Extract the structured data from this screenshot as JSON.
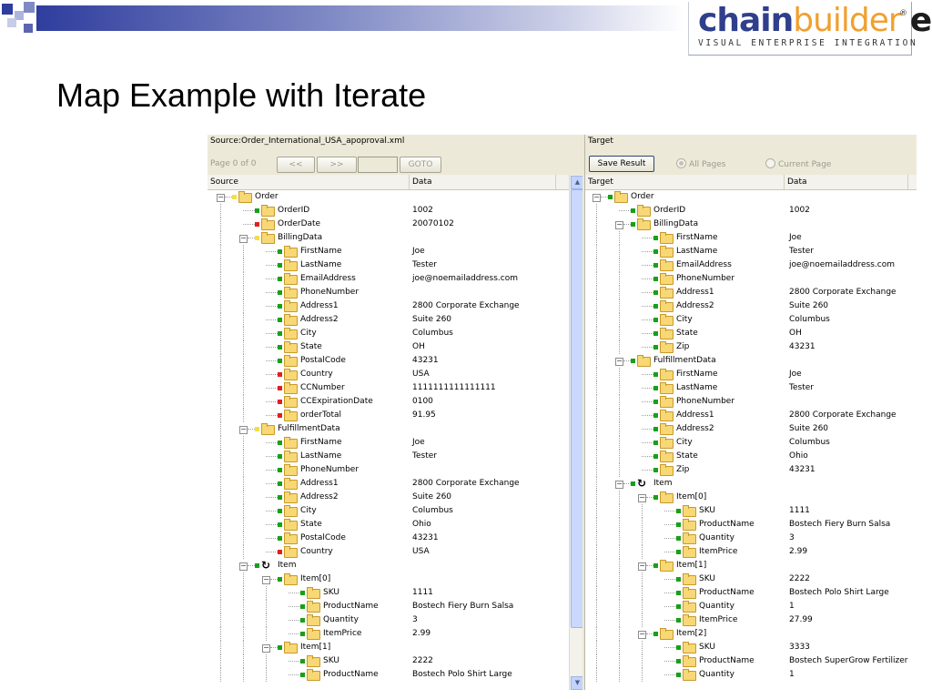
{
  "slide": {
    "title": "Map Example with Iterate",
    "logo": {
      "chain": "chain",
      "builder": "builder",
      "esb": "esb",
      "reg": "®",
      "tagline": "VISUAL ENTERPRISE INTEGRATION"
    },
    "colors": {
      "bar_dark": "#2f3d9e",
      "bar_light": "#c9cde6",
      "logo_blue": "#2f3f8c",
      "logo_orange": "#f0a030"
    }
  },
  "source_panel": {
    "header": "Source:Order_International_USA_apoproval.xml",
    "page_label": "Page 0 of 0",
    "prev_label": "<<",
    "next_label": ">>",
    "goto_label": "GOTO",
    "col_source": "Source",
    "col_data": "Data",
    "rows": [
      {
        "name": "Order",
        "value": "",
        "level": 0,
        "marker": "yellow",
        "icon": "folder",
        "expander": "minus"
      },
      {
        "name": "OrderID",
        "value": "1002",
        "level": 1,
        "marker": "green",
        "icon": "folder"
      },
      {
        "name": "OrderDate",
        "value": "20070102",
        "level": 1,
        "marker": "red",
        "icon": "folder"
      },
      {
        "name": "BillingData",
        "value": "",
        "level": 1,
        "marker": "yellow",
        "icon": "folder",
        "expander": "minus"
      },
      {
        "name": "FirstName",
        "value": "Joe",
        "level": 2,
        "marker": "green",
        "icon": "folder"
      },
      {
        "name": "LastName",
        "value": "Tester",
        "level": 2,
        "marker": "green",
        "icon": "folder"
      },
      {
        "name": "EmailAddress",
        "value": "joe@noemailaddress.com",
        "level": 2,
        "marker": "green",
        "icon": "folder"
      },
      {
        "name": "PhoneNumber",
        "value": "",
        "level": 2,
        "marker": "green",
        "icon": "folder"
      },
      {
        "name": "Address1",
        "value": "2800 Corporate Exchange",
        "level": 2,
        "marker": "green",
        "icon": "folder"
      },
      {
        "name": "Address2",
        "value": "Suite 260",
        "level": 2,
        "marker": "green",
        "icon": "folder"
      },
      {
        "name": "City",
        "value": "Columbus",
        "level": 2,
        "marker": "green",
        "icon": "folder"
      },
      {
        "name": "State",
        "value": "OH",
        "level": 2,
        "marker": "green",
        "icon": "folder"
      },
      {
        "name": "PostalCode",
        "value": "43231",
        "level": 2,
        "marker": "green",
        "icon": "folder"
      },
      {
        "name": "Country",
        "value": "USA",
        "level": 2,
        "marker": "red",
        "icon": "folder"
      },
      {
        "name": "CCNumber",
        "value": "1111111111111111",
        "level": 2,
        "marker": "red",
        "icon": "folder"
      },
      {
        "name": "CCExpirationDate",
        "value": "0100",
        "level": 2,
        "marker": "red",
        "icon": "folder"
      },
      {
        "name": "orderTotal",
        "value": "91.95",
        "level": 2,
        "marker": "red",
        "icon": "folder"
      },
      {
        "name": "FulfillmentData",
        "value": "",
        "level": 1,
        "marker": "yellow",
        "icon": "folder",
        "expander": "minus"
      },
      {
        "name": "FirstName",
        "value": "Joe",
        "level": 2,
        "marker": "green",
        "icon": "folder"
      },
      {
        "name": "LastName",
        "value": "Tester",
        "level": 2,
        "marker": "green",
        "icon": "folder"
      },
      {
        "name": "PhoneNumber",
        "value": "",
        "level": 2,
        "marker": "green",
        "icon": "folder"
      },
      {
        "name": "Address1",
        "value": "2800 Corporate Exchange",
        "level": 2,
        "marker": "green",
        "icon": "folder"
      },
      {
        "name": "Address2",
        "value": "Suite 260",
        "level": 2,
        "marker": "green",
        "icon": "folder"
      },
      {
        "name": "City",
        "value": "Columbus",
        "level": 2,
        "marker": "green",
        "icon": "folder"
      },
      {
        "name": "State",
        "value": "Ohio",
        "level": 2,
        "marker": "green",
        "icon": "folder"
      },
      {
        "name": "PostalCode",
        "value": "43231",
        "level": 2,
        "marker": "green",
        "icon": "folder"
      },
      {
        "name": "Country",
        "value": "USA",
        "level": 2,
        "marker": "red",
        "icon": "folder"
      },
      {
        "name": "Item",
        "value": "",
        "level": 1,
        "marker": "green",
        "icon": "iterate",
        "expander": "minus"
      },
      {
        "name": "Item[0]",
        "value": "",
        "level": 2,
        "marker": "green",
        "icon": "folder",
        "expander": "minus"
      },
      {
        "name": "SKU",
        "value": "1111",
        "level": 3,
        "marker": "green",
        "icon": "folder"
      },
      {
        "name": "ProductName",
        "value": "Bostech Fiery Burn Salsa",
        "level": 3,
        "marker": "green",
        "icon": "folder"
      },
      {
        "name": "Quantity",
        "value": "3",
        "level": 3,
        "marker": "green",
        "icon": "folder"
      },
      {
        "name": "ItemPrice",
        "value": "2.99",
        "level": 3,
        "marker": "green",
        "icon": "folder"
      },
      {
        "name": "Item[1]",
        "value": "",
        "level": 2,
        "marker": "green",
        "icon": "folder",
        "expander": "minus"
      },
      {
        "name": "SKU",
        "value": "2222",
        "level": 3,
        "marker": "green",
        "icon": "folder"
      },
      {
        "name": "ProductName",
        "value": "Bostech Polo Shirt Large",
        "level": 3,
        "marker": "green",
        "icon": "folder"
      }
    ]
  },
  "target_panel": {
    "header": "Target",
    "save_label": "Save Result",
    "all_pages_label": "All Pages",
    "current_page_label": "Current Page",
    "col_target": "Target",
    "col_data": "Data",
    "rows": [
      {
        "name": "Order",
        "value": "",
        "level": 0,
        "marker": "green",
        "icon": "folder",
        "expander": "minus"
      },
      {
        "name": "OrderID",
        "value": "1002",
        "level": 1,
        "marker": "green",
        "icon": "folder"
      },
      {
        "name": "BillingData",
        "value": "",
        "level": 1,
        "marker": "green",
        "icon": "folder",
        "expander": "minus"
      },
      {
        "name": "FirstName",
        "value": "Joe",
        "level": 2,
        "marker": "green",
        "icon": "folder"
      },
      {
        "name": "LastName",
        "value": "Tester",
        "level": 2,
        "marker": "green",
        "icon": "folder"
      },
      {
        "name": "EmailAddress",
        "value": "joe@noemailaddress.com",
        "level": 2,
        "marker": "green",
        "icon": "folder"
      },
      {
        "name": "PhoneNumber",
        "value": "",
        "level": 2,
        "marker": "green",
        "icon": "folder"
      },
      {
        "name": "Address1",
        "value": "2800 Corporate Exchange",
        "level": 2,
        "marker": "green",
        "icon": "folder"
      },
      {
        "name": "Address2",
        "value": "Suite 260",
        "level": 2,
        "marker": "green",
        "icon": "folder"
      },
      {
        "name": "City",
        "value": "Columbus",
        "level": 2,
        "marker": "green",
        "icon": "folder"
      },
      {
        "name": "State",
        "value": "OH",
        "level": 2,
        "marker": "green",
        "icon": "folder"
      },
      {
        "name": "Zip",
        "value": "43231",
        "level": 2,
        "marker": "green",
        "icon": "folder"
      },
      {
        "name": "FulfillmentData",
        "value": "",
        "level": 1,
        "marker": "green",
        "icon": "folder",
        "expander": "minus"
      },
      {
        "name": "FirstName",
        "value": "Joe",
        "level": 2,
        "marker": "green",
        "icon": "folder"
      },
      {
        "name": "LastName",
        "value": "Tester",
        "level": 2,
        "marker": "green",
        "icon": "folder"
      },
      {
        "name": "PhoneNumber",
        "value": "",
        "level": 2,
        "marker": "green",
        "icon": "folder"
      },
      {
        "name": "Address1",
        "value": "2800 Corporate Exchange",
        "level": 2,
        "marker": "green",
        "icon": "folder"
      },
      {
        "name": "Address2",
        "value": "Suite 260",
        "level": 2,
        "marker": "green",
        "icon": "folder"
      },
      {
        "name": "City",
        "value": "Columbus",
        "level": 2,
        "marker": "green",
        "icon": "folder"
      },
      {
        "name": "State",
        "value": "Ohio",
        "level": 2,
        "marker": "green",
        "icon": "folder"
      },
      {
        "name": "Zip",
        "value": "43231",
        "level": 2,
        "marker": "green",
        "icon": "folder"
      },
      {
        "name": "Item",
        "value": "",
        "level": 1,
        "marker": "green",
        "icon": "iterate",
        "expander": "minus"
      },
      {
        "name": "Item[0]",
        "value": "",
        "level": 2,
        "marker": "green",
        "icon": "folder",
        "expander": "minus"
      },
      {
        "name": "SKU",
        "value": "1111",
        "level": 3,
        "marker": "green",
        "icon": "folder"
      },
      {
        "name": "ProductName",
        "value": "Bostech Fiery Burn Salsa",
        "level": 3,
        "marker": "green",
        "icon": "folder"
      },
      {
        "name": "Quantity",
        "value": "3",
        "level": 3,
        "marker": "green",
        "icon": "folder"
      },
      {
        "name": "ItemPrice",
        "value": "2.99",
        "level": 3,
        "marker": "green",
        "icon": "folder"
      },
      {
        "name": "Item[1]",
        "value": "",
        "level": 2,
        "marker": "green",
        "icon": "folder",
        "expander": "minus"
      },
      {
        "name": "SKU",
        "value": "2222",
        "level": 3,
        "marker": "green",
        "icon": "folder"
      },
      {
        "name": "ProductName",
        "value": "Bostech Polo Shirt Large",
        "level": 3,
        "marker": "green",
        "icon": "folder"
      },
      {
        "name": "Quantity",
        "value": "1",
        "level": 3,
        "marker": "green",
        "icon": "folder"
      },
      {
        "name": "ItemPrice",
        "value": "27.99",
        "level": 3,
        "marker": "green",
        "icon": "folder"
      },
      {
        "name": "Item[2]",
        "value": "",
        "level": 2,
        "marker": "green",
        "icon": "folder",
        "expander": "minus"
      },
      {
        "name": "SKU",
        "value": "3333",
        "level": 3,
        "marker": "green",
        "icon": "folder"
      },
      {
        "name": "ProductName",
        "value": "Bostech SuperGrow Fertilizer",
        "level": 3,
        "marker": "green",
        "icon": "folder"
      },
      {
        "name": "Quantity",
        "value": "1",
        "level": 3,
        "marker": "green",
        "icon": "folder"
      }
    ]
  }
}
